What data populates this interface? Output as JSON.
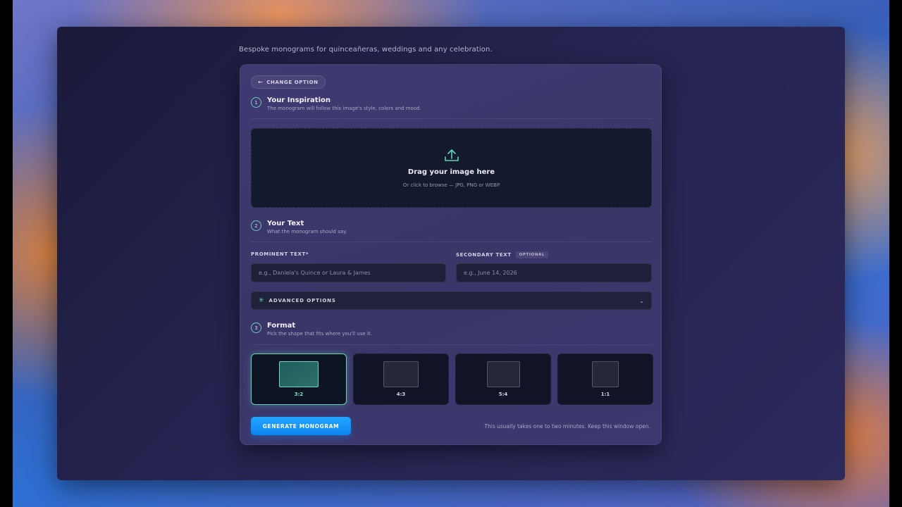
{
  "tagline": "Bespoke monograms for quinceañeras, weddings and any celebration.",
  "change_option": {
    "label": "CHANGE OPTION",
    "icon": "arrow-left-icon"
  },
  "steps": [
    {
      "number": "1",
      "title": "Your Inspiration",
      "subtitle": "The monogram will follow this image's style, colors and mood."
    },
    {
      "number": "2",
      "title": "Your Text",
      "subtitle": "What the monogram should say."
    },
    {
      "number": "3",
      "title": "Format",
      "subtitle": "Pick the shape that fits where you'll use it."
    }
  ],
  "dropzone": {
    "icon": "upload-icon",
    "title": "Drag your image here",
    "subtitle": "Or click to browse — JPG, PNG or WEBP"
  },
  "fields": {
    "prominent": {
      "label": "PROMINENT TEXT*",
      "value": "",
      "placeholder": "e.g., Daniela's Quince or Laura & James"
    },
    "secondary": {
      "label": "SECONDARY TEXT",
      "badge": "OPTIONAL",
      "value": "",
      "placeholder": "e.g., June 14, 2026"
    }
  },
  "advanced": {
    "label": "ADVANCED OPTIONS",
    "icon": "sparkle-icon",
    "chevron": "chevron-down-icon"
  },
  "formats": [
    {
      "label": "3:2",
      "selected": true
    },
    {
      "label": "4:3",
      "selected": false
    },
    {
      "label": "5:4",
      "selected": false
    },
    {
      "label": "1:1",
      "selected": false
    }
  ],
  "generate": {
    "label": "GENERATE MONOGRAM"
  },
  "hint": "This usually takes one to two minutes. Keep this window open.",
  "colors": {
    "accent": "#5fd4b3",
    "primary_button": "#1496f8",
    "card": "#3c376c"
  }
}
